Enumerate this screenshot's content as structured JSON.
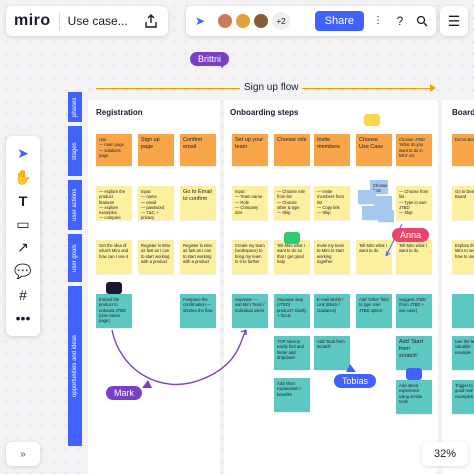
{
  "app": {
    "logo": "miro",
    "board_title": "Use case..."
  },
  "header": {
    "share_label": "Share",
    "collaborator_count": "+2",
    "zoom": "32%"
  },
  "frame": {
    "title": "Sign up flow"
  },
  "rows": [
    "phases",
    "stages",
    "user actions",
    "user goals",
    "opportunities and ideas"
  ],
  "columns": {
    "registration": "Registration",
    "onboarding": "Onboarding steps",
    "board": "Board"
  },
  "notes": {
    "s1": "Use\n— main page\n— solutions page",
    "s2": "Sign up page",
    "s3": "Confirm email",
    "s4": "Set up your team",
    "s5": "Choose role",
    "s6": "Invite members",
    "s7": "Choose Use Case",
    "s8": "Choose JTBD\n'What do you want to do in Miro' etc",
    "s9": "Demo Boa",
    "a1": "— explore the product features\n— explore examples\n— compare plans\n— browse templates",
    "a2": "Input:\n— name\n— email\n— password\n— T&C + privacy",
    "a3": "Go to Email to confirm",
    "a4": "Input:\n— Team name\n— Role\n— Company size",
    "a5": "— Choose role from list\n— Choose other & type\n— Skip",
    "a6": "— Invite members from list\n— Copy link\n— Skip",
    "a7": "Choose from list",
    "a8": "— Choose from list\n— Type in own JTBD\n— Skip",
    "a9": "Go to Demo Board",
    "g1": "Get the idea of what's Miro and how can I use it",
    "g2": "Register in Miro as fast as I can to start working with a product",
    "g3": "Register in Miro as fast as I can to start working with a product",
    "g4": "Create my team (workspace) to bring my team to it to further",
    "g5": "Tell Miro what I want to do so that I get good help",
    "g6": "Invite my team to Miro to start working together",
    "g7": "Tell Miro what I want to do",
    "g8": "Tell Miro what I want to do",
    "g9": "Explore the Miro to see how to use it",
    "i1": "Embed the product to onboard JTBD (Use cases page)",
    "i2": "Postpone the confirmation — shorten the flow",
    "i3": "Separate — suit Miro Team / Individual users",
    "i4": "Separate step (JTBD) product? Clarify + focus",
    "i5": "E-mail labels / Link (Block / Guidance)",
    "i6": "Add 'Other' field to type own JTBD option",
    "i7": "Suggest JTBD (from JTBD + use case)",
    "i8": "TOP roles to easily find and faster add dropdown",
    "i9": "Add 'Start from scratch'",
    "i10": "Add 'Start from scratch'",
    "i11": "Add short explanation / benefits",
    "i12": "Add about experience using similar tools",
    "i13": "Add 'Start from scratch' option",
    "i14": "Use the best valuable example",
    "i15": "Trigger to good real examples"
  },
  "cursors": {
    "brittni": "Brittni",
    "anna": "Anna",
    "mark": "Mark",
    "tobias": "Tobias"
  },
  "colors": {
    "accent": "#4262ff",
    "purple": "#7b3fc6",
    "orange": "#f2a100"
  }
}
